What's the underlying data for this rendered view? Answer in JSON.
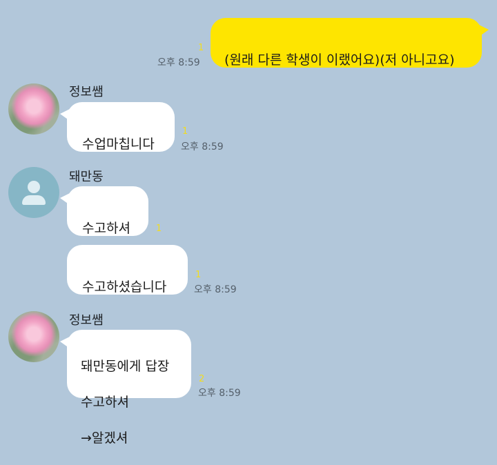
{
  "messages": {
    "m1": {
      "text": "(원래 다른 학생이 이랬어요)(저 아니고요)",
      "unread": "1",
      "time": "오후 8:59"
    },
    "g1": {
      "sender": "정보쌤",
      "text": "수업마칩니다",
      "unread": "1",
      "time": "오후 8:59"
    },
    "g2": {
      "sender": "돼만동",
      "msg_a": {
        "text": "수고하셔",
        "unread": "1"
      },
      "msg_b": {
        "text": "수고하셨습니다",
        "unread": "1",
        "time": "오후 8:59"
      }
    },
    "g3": {
      "sender": "정보쌤",
      "reply_header": "돼만동에게 답장",
      "quoted": "수고하셔",
      "text": "→알겠셔",
      "unread": "2",
      "time": "오후 8:59"
    }
  },
  "colors": {
    "background": "#b2c7da",
    "my_bubble": "#fee500",
    "other_bubble": "#ffffff",
    "unread_count": "#f2dc1f"
  }
}
